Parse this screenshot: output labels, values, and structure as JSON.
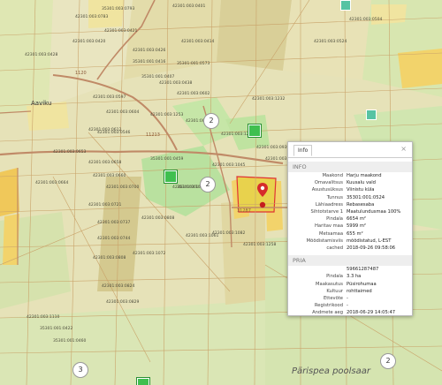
{
  "map": {
    "place_labels": {
      "village": "Aaviku",
      "area": "Pärispea poolsaar"
    },
    "cluster_counts": [
      "2",
      "2",
      "3",
      "2"
    ],
    "road_labels": [
      "1120",
      "11213",
      "11287"
    ],
    "parcel_ids": [
      "42301:003:0401",
      "42301:003:0414",
      "35301:003:0793",
      "42301:003:0783",
      "42301:003:0420",
      "42301:003:0421",
      "42301:003:0426",
      "42301:003:0428",
      "35301:001:0573",
      "35301:001:0416",
      "35301:001:0407",
      "42301:003:0438",
      "42301:003:0602",
      "42301:003:0604",
      "42301:003:0594",
      "42301:003:0612",
      "42301:003:0653",
      "42301:003:0664",
      "42301:003:0658",
      "42301:003:0660",
      "42301:003:0700",
      "42301:003:0721",
      "42301:003:0737",
      "42301:003:0744",
      "42301:003:0808",
      "42301:003:0808",
      "42301:003:0824",
      "42301:003:0829",
      "42301:003:1072",
      "42301:003:1069",
      "42301:003:0939",
      "42301:003:0943",
      "42301:003:1045",
      "42301:003:1061",
      "42301:003:1082",
      "42301:003:1110",
      "35301:001:0422",
      "35301:001:0460",
      "35301:001:0459",
      "35301:001:0454",
      "42301:003:1218",
      "42301:003:1232",
      "42301:003:1253",
      "42301:003:1258",
      "42301:003:0546",
      "42301:003:0597",
      "42301:003:0504",
      "42301:003:0524"
    ],
    "colors": {
      "parcel_fill": "#e3dfad",
      "parcel_fill_alt": "#d8cc96",
      "forest": "#c9e4a8",
      "highlight": "#8fd68b",
      "line": "#c9a36a",
      "road": "#c08a67",
      "built": "#f2d36b"
    }
  },
  "info_panel": {
    "tab": "Info",
    "close_icon": "×",
    "section_info": "INFO",
    "info_rows": [
      {
        "k": "Maakond",
        "v": "Harju maakond"
      },
      {
        "k": "Omavalitsus",
        "v": "Kuusalu vald"
      },
      {
        "k": "Asustusüksus",
        "v": "Viinistu küla"
      },
      {
        "k": "Tunnus",
        "v": "35301:001:0524"
      },
      {
        "k": "Lähiaadress",
        "v": "Rebasesaba"
      },
      {
        "k": "Sihtotstarve 1",
        "v": "Maatulundusmaa 100%"
      },
      {
        "k": "Pindala",
        "v": "6654 m²"
      },
      {
        "k": "Haritav maa",
        "v": "5999 m²"
      },
      {
        "k": "Metsamaa",
        "v": "655 m²"
      },
      {
        "k": "Mõõdistamisviis",
        "v": "mõõdistatud, L-EST"
      },
      {
        "k": "cached",
        "v": "2018-09-26 09:58:06"
      }
    ],
    "section_pria": "PRIA",
    "pria_rows": [
      {
        "k": "",
        "v": "59661287487"
      },
      {
        "k": "Pindala",
        "v": "3.3 ha"
      },
      {
        "k": "Maakasutus",
        "v": "Püsirohumaa"
      },
      {
        "k": "Kultuur",
        "v": "rohttaimed"
      },
      {
        "k": "Ettevõte",
        "v": "-"
      },
      {
        "k": "Registrikood",
        "v": "-"
      },
      {
        "k": "Andmete aeg",
        "v": "2018-06-29 14:05:47"
      }
    ]
  }
}
